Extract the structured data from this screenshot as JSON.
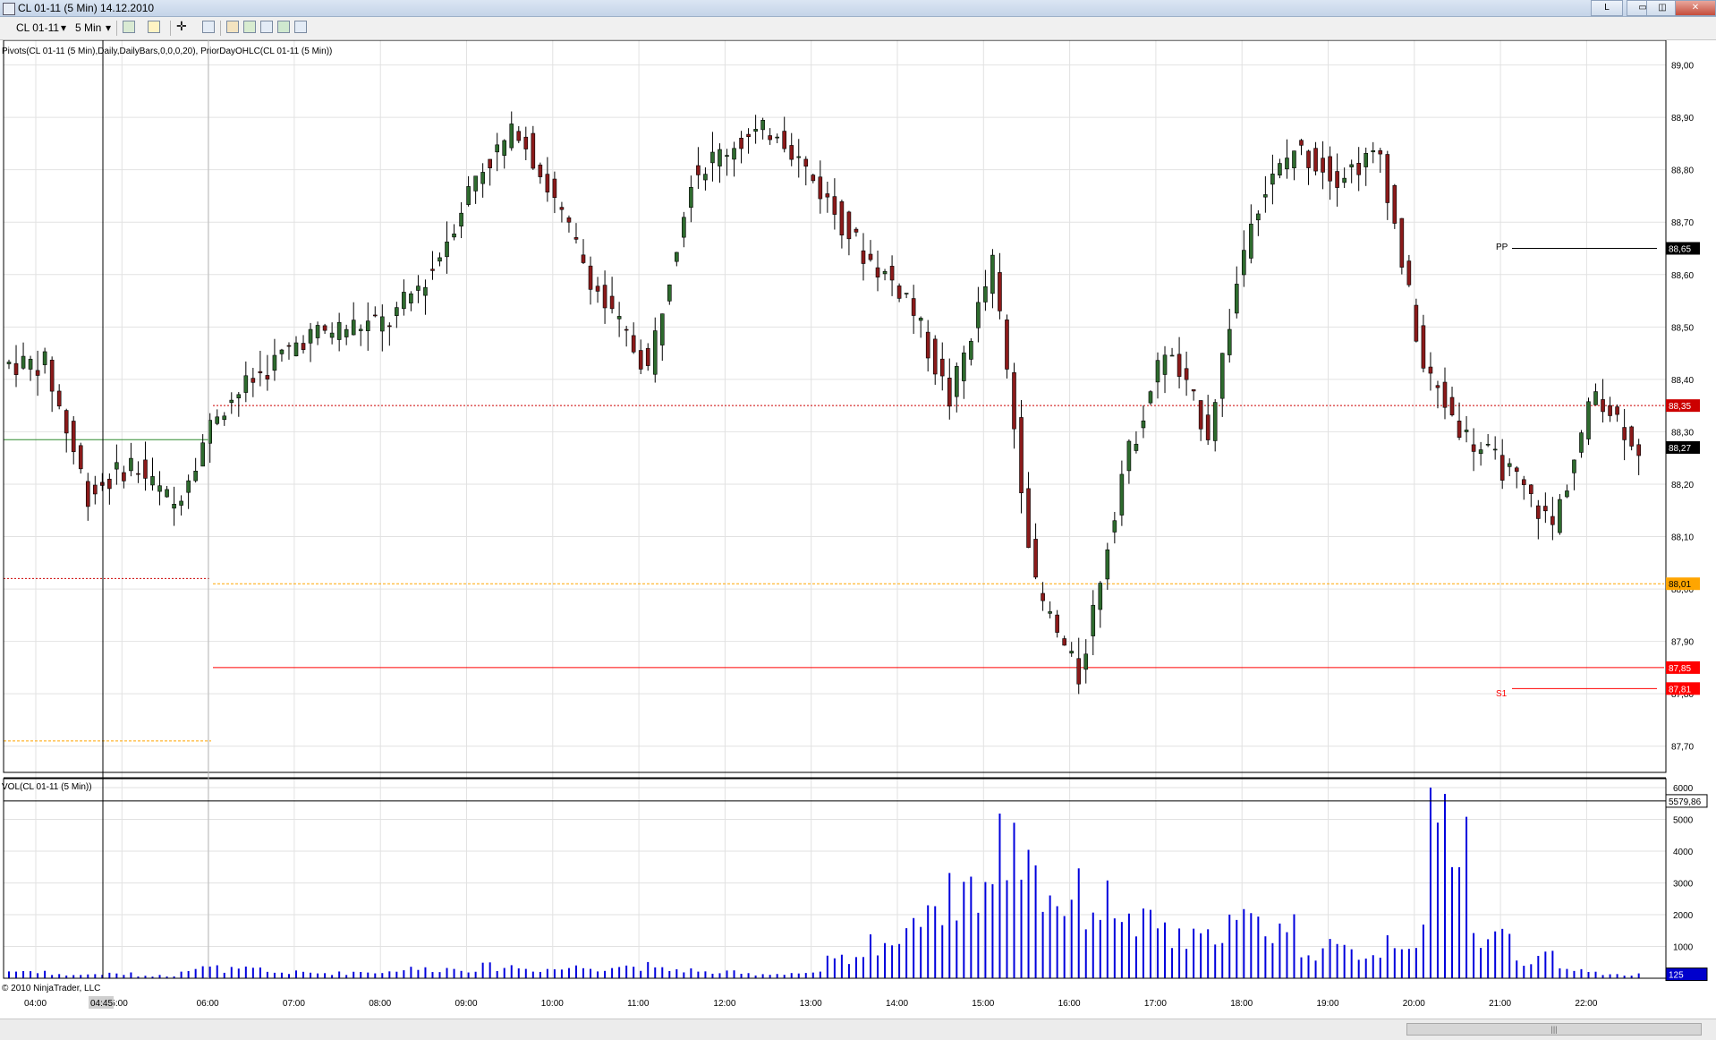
{
  "window": {
    "title": "CL 01-11 (5 Min)  14.12.2010",
    "buttons": [
      "L",
      "▭",
      "◫",
      "✕"
    ]
  },
  "toolbar": {
    "instrument": "CL 01-11",
    "interval": "5 Min"
  },
  "price_panel": {
    "indicator_label": "Pivots(CL 01-11 (5 Min),Daily,DailyBars,0,0,0,20), PriorDayOHLC(CL 01-11 (5 Min))",
    "y_ticks": [
      "89,00",
      "88,90",
      "88,80",
      "88,70",
      "88,60",
      "88,50",
      "88,40",
      "88,30",
      "88,20",
      "88,10",
      "88,00",
      "87,90",
      "87,80",
      "87,70"
    ],
    "markers": [
      {
        "text": "88,65",
        "bg": "#000000",
        "color": "#ffffff"
      },
      {
        "text": "88,35",
        "bg": "#cc0000",
        "color": "#ffffff"
      },
      {
        "text": "88,27",
        "bg": "#000000",
        "color": "#ffffff"
      },
      {
        "text": "88,01",
        "bg": "#ffa500",
        "color": "#000000"
      },
      {
        "text": "87,85",
        "bg": "#ff0000",
        "color": "#ffffff"
      },
      {
        "text": "87,81",
        "bg": "#ff0000",
        "color": "#ffffff"
      }
    ],
    "pivot_labels": {
      "pp": "PP",
      "s1": "S1"
    }
  },
  "volume_panel": {
    "label": "VOL(CL 01-11 (5 Min))",
    "y_ticks": [
      "6000",
      "5000",
      "4000",
      "3000",
      "2000",
      "1000"
    ],
    "markers": [
      {
        "text": "5579,86",
        "bg": "#ffffff",
        "color": "#000000"
      },
      {
        "text": "125",
        "bg": "#0000cc",
        "color": "#ffffff"
      }
    ]
  },
  "time_axis": {
    "labels": [
      "04:00",
      "5:00",
      "06:00",
      "07:00",
      "08:00",
      "09:00",
      "10:00",
      "11:00",
      "12:00",
      "13:00",
      "14:00",
      "15:00",
      "16:00",
      "17:00",
      "18:00",
      "19:00",
      "20:00",
      "21:00",
      "22:00"
    ],
    "cursor_label": "04:45"
  },
  "copyright": "© 2010 NinjaTrader, LLC",
  "colors": {
    "up_candle": "#2e6b2e",
    "down_candle": "#8b1a1a",
    "volume": "#0000dd",
    "pp_line": "#000000",
    "s1_line": "#ff0000"
  },
  "chart_data": {
    "type": "candlestick",
    "interval": "5 Min",
    "instrument": "CL 01-11",
    "ylim": [
      87.65,
      89.03
    ],
    "x": [
      "04:00",
      "04:30",
      "05:00",
      "05:30",
      "06:00",
      "06:30",
      "07:00",
      "07:30",
      "08:00",
      "08:30",
      "09:00",
      "09:30",
      "10:00",
      "10:30",
      "11:00",
      "11:30",
      "12:00",
      "12:30",
      "13:00",
      "13:30",
      "14:00",
      "14:30",
      "15:00",
      "15:30",
      "16:00",
      "16:30",
      "17:00",
      "17:30",
      "18:00",
      "18:30",
      "19:00",
      "19:30",
      "20:00",
      "20:30",
      "21:00",
      "21:30",
      "22:00",
      "22:30"
    ],
    "close": [
      88.43,
      88.18,
      88.24,
      88.16,
      88.34,
      88.41,
      88.48,
      88.5,
      88.51,
      88.61,
      88.79,
      88.88,
      88.71,
      88.54,
      88.42,
      88.79,
      88.85,
      88.88,
      88.76,
      88.64,
      88.56,
      88.36,
      88.62,
      88.0,
      87.83,
      88.22,
      88.46,
      88.3,
      88.72,
      88.84,
      88.79,
      88.83,
      88.42,
      88.29,
      88.22,
      88.12,
      88.38,
      88.27
    ],
    "volume": [
      250,
      120,
      150,
      90,
      350,
      300,
      200,
      180,
      220,
      320,
      330,
      400,
      320,
      380,
      420,
      300,
      200,
      150,
      180,
      600,
      1300,
      2700,
      3200,
      4600,
      2800,
      2600,
      1800,
      1300,
      1900,
      1800,
      1000,
      900,
      1400,
      5580,
      1400,
      700,
      300,
      125
    ],
    "pivots": {
      "PP": 88.65,
      "S1": 87.81
    },
    "levels": [
      88.65,
      88.35,
      88.27,
      88.01,
      87.85,
      87.81
    ],
    "volume_ylim": [
      0,
      6000
    ]
  }
}
